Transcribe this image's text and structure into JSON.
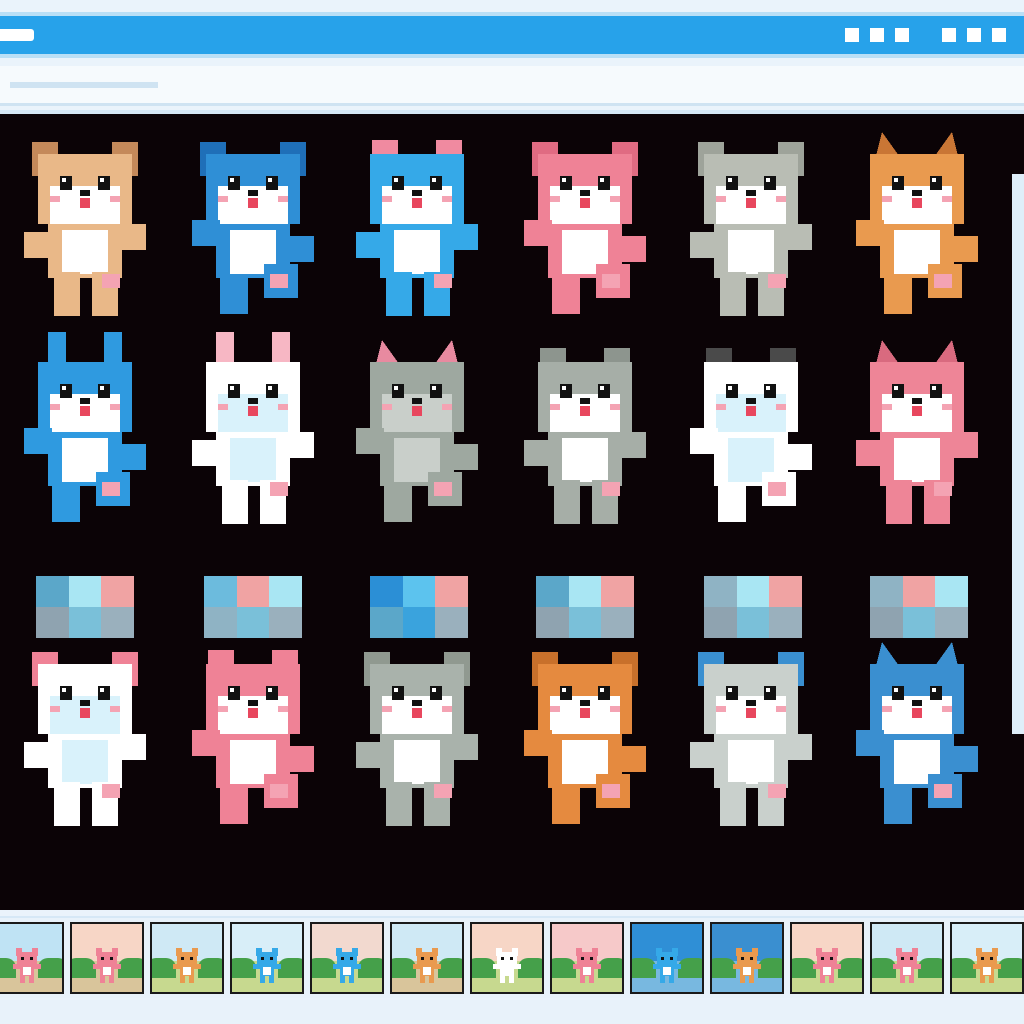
{
  "window": {
    "titlebar_color": "#27a2ea",
    "window_buttons": [
      "window-button",
      "window-button",
      "window-button",
      "window-button",
      "window-button",
      "window-button"
    ]
  },
  "sprite_sheet": {
    "background": "#0b0306",
    "sprites": [
      {
        "name": "tan-puppy",
        "color": "#e9b888",
        "accent": "#ffffff",
        "ear": "#c4895a",
        "ears": "floppy"
      },
      {
        "name": "blue-puppy",
        "color": "#2f8fd6",
        "accent": "#ffffff",
        "ear": "#1f6fb8",
        "ears": "floppy"
      },
      {
        "name": "blue-cat",
        "color": "#35a9e8",
        "accent": "#ffffff",
        "ear": "#f08aa0",
        "ears": "round"
      },
      {
        "name": "pink-puppy",
        "color": "#ef8296",
        "accent": "#ffffff",
        "ear": "#e06b82",
        "ears": "floppy"
      },
      {
        "name": "gray-puppy",
        "color": "#b9bdb4",
        "accent": "#ffffff",
        "ear": "#9ea39a",
        "ears": "floppy"
      },
      {
        "name": "orange-fox",
        "color": "#e99a4f",
        "accent": "#ffffff",
        "ear": "#c97635",
        "ears": "pointy"
      },
      {
        "name": "blue-bunny",
        "color": "#2f9ae0",
        "accent": "#ffffff",
        "ear": "#2f9ae0",
        "ears": "long"
      },
      {
        "name": "white-bunny",
        "color": "#ffffff",
        "accent": "#d9f2fb",
        "ear": "#f7b7c4",
        "ears": "long"
      },
      {
        "name": "gray-cat",
        "color": "#9ea8a0",
        "accent": "#c9cfca",
        "ear": "#e88aa0",
        "ears": "pointy"
      },
      {
        "name": "gray-dog",
        "color": "#a6aea7",
        "accent": "#ffffff",
        "ear": "#8d958e",
        "ears": "round"
      },
      {
        "name": "white-panda",
        "color": "#ffffff",
        "accent": "#d9f2fb",
        "ear": "#4a4a4a",
        "ears": "round"
      },
      {
        "name": "pink-fox",
        "color": "#ee8597",
        "accent": "#ffffff",
        "ear": "#d96a7f",
        "ears": "pointy"
      },
      {
        "name": "pink-eared-dog",
        "color": "#ffffff",
        "accent": "#d9f2fb",
        "ear": "#ef8296",
        "ears": "floppy"
      },
      {
        "name": "pink-bear",
        "color": "#ef8296",
        "accent": "#ffffff",
        "ear": "#ef8296",
        "ears": "round"
      },
      {
        "name": "gray-dancer",
        "color": "#a9b2ab",
        "accent": "#ffffff",
        "ear": "#909990",
        "ears": "floppy"
      },
      {
        "name": "orange-dog",
        "color": "#e58a3f",
        "accent": "#ffffff",
        "ear": "#c8702b",
        "ears": "floppy"
      },
      {
        "name": "gray-blue-dog",
        "color": "#c9d0cc",
        "accent": "#ffffff",
        "ear": "#3a8fd0",
        "ears": "floppy"
      },
      {
        "name": "blue-plaid-dog",
        "color": "#3a8fd0",
        "accent": "#ffffff",
        "ear": "#3a8fd0",
        "ears": "pointy"
      }
    ],
    "palettes": [
      [
        "#5ba7c9",
        "#a9e6f3",
        "#f0a3a3",
        "#8fa3b0",
        "#7ac0d9",
        "#9ab0bd"
      ],
      [
        "#6cbbdd",
        "#f0a3a3",
        "#a9e6f3",
        "#8fb3c4",
        "#7ac0d9",
        "#9ab0bd"
      ],
      [
        "#2b8fd6",
        "#5cc3ee",
        "#f0a3a3",
        "#5ba7c9",
        "#3aa3dd",
        "#9ab0bd"
      ],
      [
        "#5ba7c9",
        "#a9e6f3",
        "#f0a3a3",
        "#8fa3b0",
        "#7ac0d9",
        "#9ab0bd"
      ],
      [
        "#8fb3c4",
        "#a9e6f3",
        "#f0a3a3",
        "#8fa3b0",
        "#7ac0d9",
        "#9ab0bd"
      ],
      [
        "#8fb3c4",
        "#f0a3a3",
        "#a9e6f3",
        "#8fa3b0",
        "#7ac0d9",
        "#9ab0bd"
      ]
    ]
  },
  "animation_frames": [
    {
      "name": "frame-1",
      "sky": "#bfe3f4",
      "ground": "#d9c59b",
      "sprite": "#ef8296"
    },
    {
      "name": "frame-2",
      "sky": "#f7d6c6",
      "ground": "#d9c59b",
      "sprite": "#ef8296"
    },
    {
      "name": "frame-3",
      "sky": "#cfe9f5",
      "ground": "#c7d98f",
      "sprite": "#e99a4f"
    },
    {
      "name": "frame-4",
      "sky": "#d8eef8",
      "ground": "#c7d98f",
      "sprite": "#35a9e8"
    },
    {
      "name": "frame-5",
      "sky": "#f2d9cf",
      "ground": "#c7d98f",
      "sprite": "#35a9e8"
    },
    {
      "name": "frame-6",
      "sky": "#cfe9f5",
      "ground": "#d9c59b",
      "sprite": "#e99a4f"
    },
    {
      "name": "frame-7",
      "sky": "#f7d6c6",
      "ground": "#c7d98f",
      "sprite": "#ffffff"
    },
    {
      "name": "frame-8",
      "sky": "#f6c9c9",
      "ground": "#c7d98f",
      "sprite": "#ef8296"
    },
    {
      "name": "frame-9",
      "sky": "#2f8fd6",
      "ground": "#78b8e0",
      "sprite": "#35a9e8"
    },
    {
      "name": "frame-10",
      "sky": "#3a8fd0",
      "ground": "#78b8e0",
      "sprite": "#e99a4f"
    },
    {
      "name": "frame-11",
      "sky": "#f7d6c6",
      "ground": "#c7d98f",
      "sprite": "#ef8296"
    },
    {
      "name": "frame-12",
      "sky": "#cfe9f5",
      "ground": "#c7d98f",
      "sprite": "#ef8296"
    },
    {
      "name": "frame-13",
      "sky": "#d8eef8",
      "ground": "#c7d98f",
      "sprite": "#e99a4f"
    }
  ]
}
